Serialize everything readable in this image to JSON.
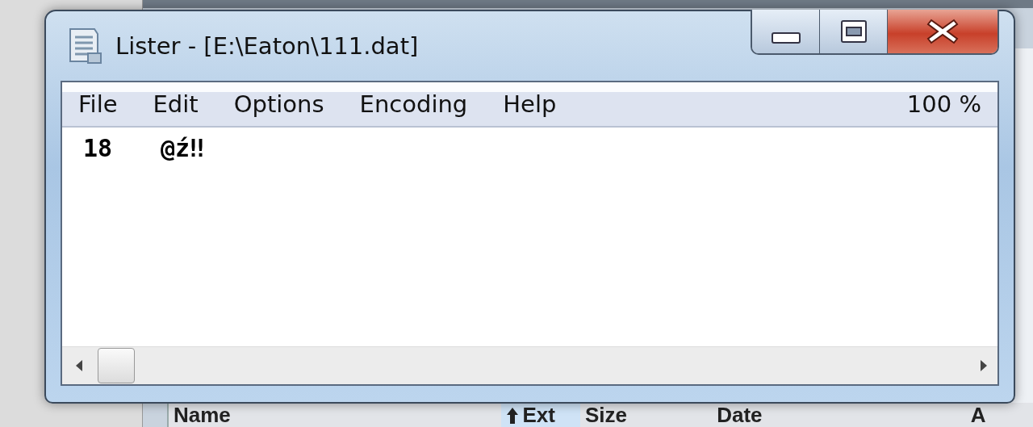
{
  "window": {
    "title": "Lister - [E:\\Eaton\\111.dat]",
    "zoom": "100 %"
  },
  "menu": [
    "File",
    "Edit",
    "Options",
    "Encoding",
    "Help"
  ],
  "lines": [
    {
      "number": "18",
      "text": "@ź‼"
    }
  ],
  "background_columns": [
    {
      "label": "Name",
      "sorted": false
    },
    {
      "label": "Ext",
      "sorted": true
    },
    {
      "label": "Size",
      "sorted": false
    },
    {
      "label": "Date",
      "sorted": false
    },
    {
      "label": "A",
      "sorted": false
    }
  ]
}
